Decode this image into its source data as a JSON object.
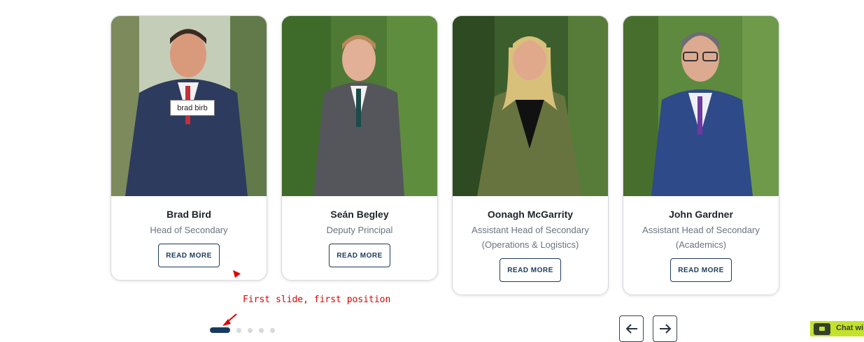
{
  "staff": [
    {
      "name": "Brad Bird",
      "role_lines": [
        "Head of Secondary"
      ],
      "button": "READ MORE"
    },
    {
      "name": "Seán Begley",
      "role_lines": [
        "Deputy Principal"
      ],
      "button": "READ MORE"
    },
    {
      "name": "Oonagh McGarrity",
      "role_lines": [
        "Assistant Head of Secondary",
        "(Operations & Logistics)"
      ],
      "button": "READ MORE"
    },
    {
      "name": "John Gardner",
      "role_lines": [
        "Assistant Head of Secondary",
        "(Academics)"
      ],
      "button": "READ MORE"
    }
  ],
  "tooltip": "brad birb",
  "annotation": "First slide, first position",
  "carousel": {
    "dot_count": 5,
    "active_index": 0
  },
  "chat": {
    "label": "Chat wi"
  },
  "colors": {
    "accent": "#1d3b5c",
    "annotation": "#e00000",
    "chat": "#c5e22b"
  }
}
